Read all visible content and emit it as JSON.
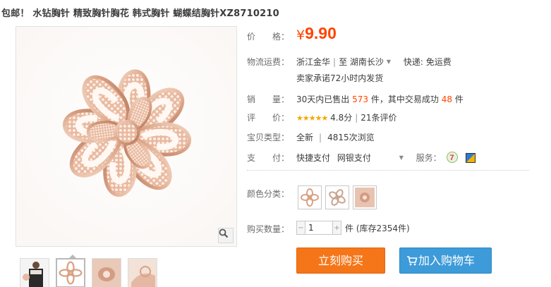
{
  "title": "包邮！ 水钻胸针 精致胸针胸花 韩式胸针 蝴蝶结胸针XZ8710210",
  "price": {
    "label": "价　　格：",
    "symbol": "¥",
    "value": "9.90"
  },
  "shipping": {
    "label": "物流运费：",
    "from": "浙江金华",
    "to_prefix": "至",
    "to": "湖南长沙",
    "fee": "快递: 免运费",
    "promise": "卖家承诺72小时内发货"
  },
  "sales": {
    "label": "销　　量：",
    "prefix": "30天内已售出",
    "count": "573",
    "mid": "件，其中交易成功",
    "success": "48",
    "suffix": "件"
  },
  "rating": {
    "label": "评　　价：",
    "stars": "★★★★★",
    "score": "4.8分",
    "reviews": "21条评价"
  },
  "type": {
    "label": "宝贝类型：",
    "condition": "全新",
    "views": "4815次浏览"
  },
  "payment": {
    "label": "支　　付：",
    "method1": "快捷支付",
    "method2": "网银支付",
    "service_label": "服务："
  },
  "color": {
    "label": "颜色分类："
  },
  "quantity": {
    "label": "购买数量：",
    "value": "1",
    "stock": "件 (库存2354件)"
  },
  "buttons": {
    "buy": "立刻购买",
    "cart": "加入购物车"
  },
  "icons": [
    "zoom-icon",
    "dropdown-icon",
    "seven-day-icon",
    "shield-icon",
    "cart-icon"
  ],
  "colors": {
    "price": "#ff4400",
    "buy": "#f57619",
    "cart": "#3e9bd9",
    "rose_gold": "#d9a184"
  }
}
